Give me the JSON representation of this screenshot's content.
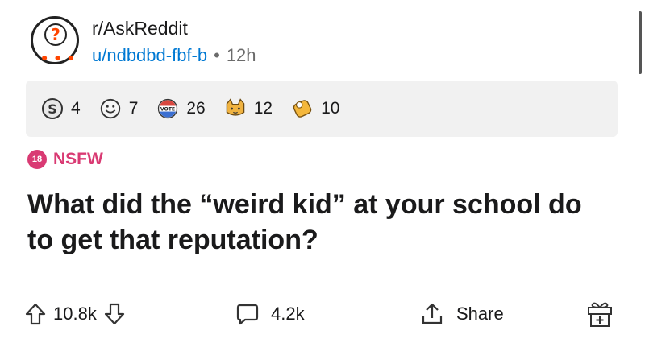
{
  "post": {
    "subreddit": "r/AskReddit",
    "author": "u/ndbdbd-fbf-b",
    "separator": "•",
    "age": "12h",
    "flair": {
      "badge": "18",
      "label": "NSFW",
      "color": "#d93a73"
    },
    "title": "What did the “weird kid” at your school do to get that reputation?"
  },
  "awards": [
    {
      "icon": "silver-award-icon",
      "count": "4"
    },
    {
      "icon": "wholesome-award-icon",
      "count": "7"
    },
    {
      "icon": "vote-award-icon",
      "count": "26"
    },
    {
      "icon": "cat-award-icon",
      "count": "12"
    },
    {
      "icon": "helpful-award-icon",
      "count": "10"
    }
  ],
  "actions": {
    "upvotes": "10.8k",
    "comments": "4.2k",
    "share_label": "Share"
  },
  "colors": {
    "link_blue": "#0079d3",
    "nsfw_pink": "#d93a73",
    "award_bar_bg": "#f1f1f1"
  }
}
